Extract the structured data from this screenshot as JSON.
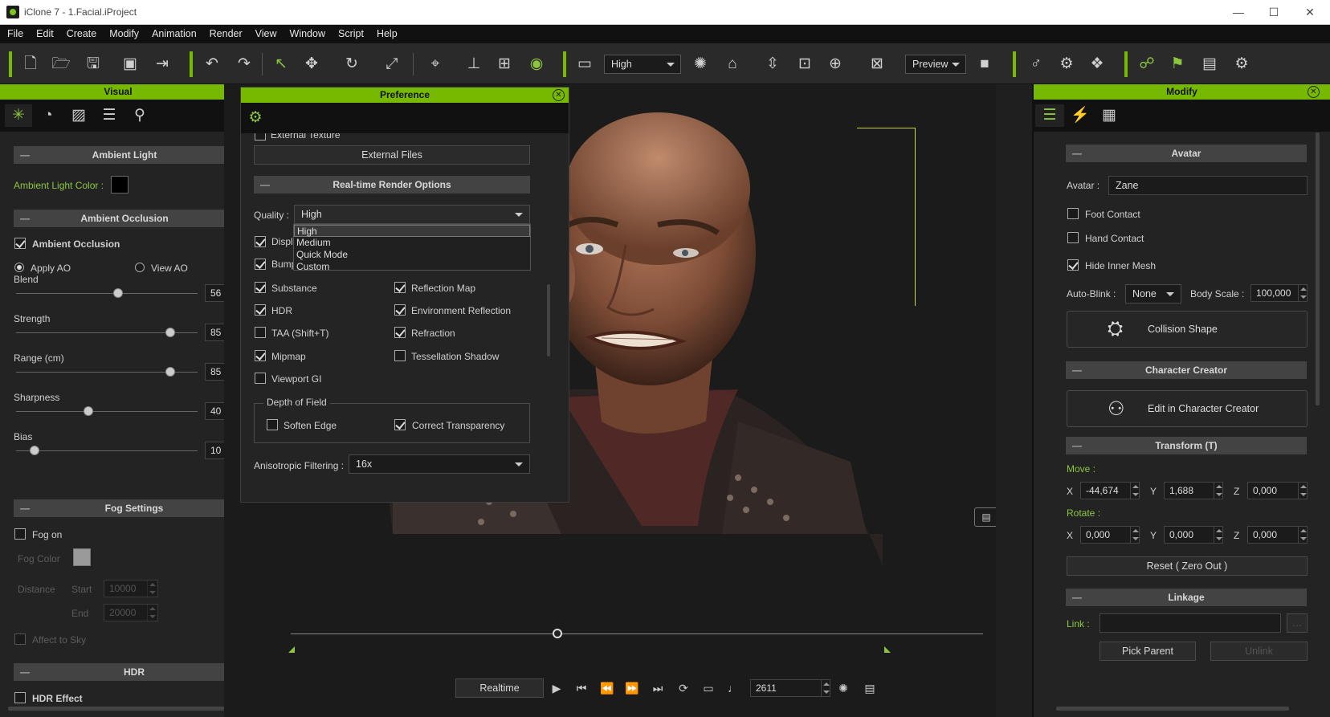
{
  "window": {
    "title": "iClone 7 - 1.Facial.iProject",
    "minimize": "—",
    "maximize": "☐",
    "close": "✕"
  },
  "menu": [
    "File",
    "Edit",
    "Create",
    "Modify",
    "Animation",
    "Render",
    "View",
    "Window",
    "Script",
    "Help"
  ],
  "toolbar": {
    "quality_value": "High",
    "preview_value": "Preview"
  },
  "visual_panel": {
    "title": "Visual",
    "ambient_light": {
      "header": "Ambient Light",
      "color_label": "Ambient Light Color :",
      "color": "#000000"
    },
    "ambient_occlusion": {
      "header": "Ambient Occlusion",
      "enable_label": "Ambient Occlusion",
      "enabled": true,
      "apply_ao": "Apply AO",
      "view_ao": "View AO",
      "sliders": [
        {
          "label": "Blend",
          "value": "56",
          "fraction": 0.56
        },
        {
          "label": "Strength",
          "value": "85",
          "fraction": 0.85
        },
        {
          "label": "Range (cm)",
          "value": "85",
          "fraction": 0.85
        },
        {
          "label": "Sharpness",
          "value": "40",
          "fraction": 0.4
        },
        {
          "label": "Bias",
          "value": "10",
          "fraction": 0.1
        }
      ]
    },
    "fog": {
      "header": "Fog Settings",
      "fog_on": "Fog on",
      "fog_color": "Fog Color",
      "distance": "Distance",
      "start": "Start",
      "start_value": "10000",
      "end": "End",
      "end_value": "20000",
      "affect_sky": "Affect to Sky"
    },
    "hdr": {
      "header": "HDR",
      "effect": "HDR Effect"
    }
  },
  "preference": {
    "title": "Preference",
    "cut_label": "External Texture",
    "external_files": "External Files",
    "rt_header": "Real-time Render Options",
    "quality_label": "Quality :",
    "quality_value": "High",
    "quality_options": [
      "High",
      "Medium",
      "Quick Mode",
      "Custom"
    ],
    "partial_left_1": "Displ",
    "partial_left_2": "Bump",
    "options_left": [
      "Substance",
      "HDR",
      "TAA (Shift+T)",
      "Mipmap",
      "Viewport GI"
    ],
    "options_left_checked": [
      true,
      true,
      false,
      true,
      false
    ],
    "options_right": [
      "Reflection Map",
      "Environment Reflection",
      "Refraction",
      "Tessellation Shadow"
    ],
    "options_right_checked": [
      true,
      true,
      true,
      false
    ],
    "dof_legend": "Depth of Field",
    "soften_edge": "Soften Edge",
    "correct_transparency": "Correct Transparency",
    "aniso_label": "Anisotropic Filtering :",
    "aniso_value": "16x"
  },
  "playback": {
    "mode": "Realtime",
    "frame": "2611"
  },
  "modify_panel": {
    "title": "Modify",
    "avatar": {
      "header": "Avatar",
      "label": "Avatar :",
      "value": "Zane",
      "foot_contact": "Foot Contact",
      "hand_contact": "Hand Contact",
      "hide_inner_mesh": "Hide Inner Mesh",
      "auto_blink_label": "Auto-Blink :",
      "auto_blink_value": "None",
      "body_scale_label": "Body Scale :",
      "body_scale_value": "100,000",
      "collision_shape": "Collision Shape"
    },
    "character_creator": {
      "header": "Character Creator",
      "edit": "Edit in Character Creator"
    },
    "transform": {
      "header": "Transform  (T)",
      "move_label": "Move :",
      "move": {
        "x": "-44,674",
        "y": "1,688",
        "z": "0,000"
      },
      "rotate_label": "Rotate :",
      "rotate": {
        "x": "0,000",
        "y": "0,000",
        "z": "0,000"
      },
      "reset": "Reset ( Zero Out )",
      "axis_x": "X",
      "axis_y": "Y",
      "axis_z": "Z"
    },
    "linkage": {
      "header": "Linkage",
      "link_label": "Link :",
      "pick_parent": "Pick Parent",
      "unlink": "Unlink"
    }
  }
}
